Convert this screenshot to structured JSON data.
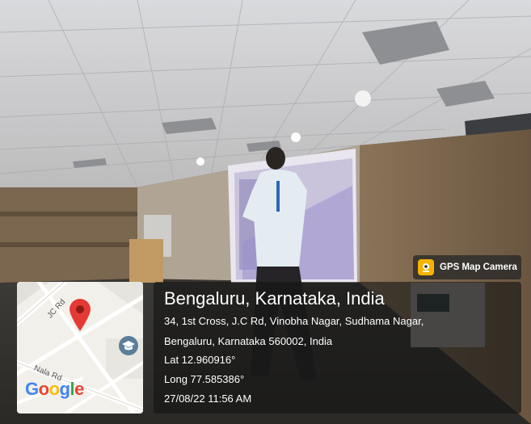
{
  "overlay": {
    "badge_label": "GPS Map Camera",
    "city_line": "Bengaluru, Karnataka, India",
    "address_line1": "34, 1st Cross, J.C Rd, Vinobha Nagar, Sudhama Nagar,",
    "address_line2": "Bengaluru, Karnataka 560002, India",
    "latitude": "Lat 12.960916°",
    "longitude": "Long 77.585386°",
    "datetime": "27/08/22 11:56 AM"
  },
  "map": {
    "road_label_1": "JC Rd",
    "road_label_2": "Nala Rd",
    "logo_text": "Google",
    "marker_color": "#e53935",
    "poi_icon": "school-icon"
  },
  "colors": {
    "badge_accent": "#f4b400",
    "panel_text": "#ffffff"
  }
}
